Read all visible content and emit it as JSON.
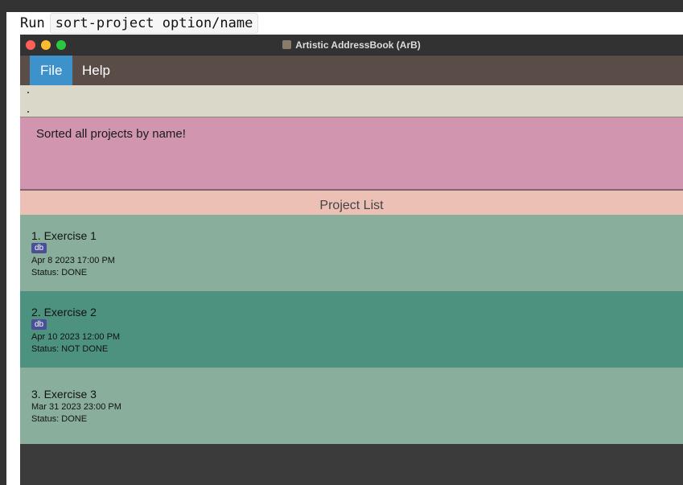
{
  "caption": {
    "prefix": "Run",
    "command": "sort-project option/name"
  },
  "window": {
    "title": "Artistic AddressBook (ArB)"
  },
  "menubar": {
    "items": [
      "File",
      "Help"
    ]
  },
  "result": {
    "message": "Sorted all projects by name!"
  },
  "list": {
    "header": "Project List",
    "projects": [
      {
        "title": "1.  Exercise 1",
        "tag": "db",
        "deadline": "Apr 8 2023 17:00 PM",
        "status": "Status: DONE",
        "selected": false
      },
      {
        "title": "2.  Exercise 2",
        "tag": "db",
        "deadline": "Apr 10 2023 12:00 PM",
        "status": "Status: NOT DONE",
        "selected": true
      },
      {
        "title": "3.  Exercise 3",
        "deadline": "Mar 31 2023 23:00 PM",
        "status": "Status: DONE",
        "selected": false
      }
    ]
  },
  "colors": {
    "menu_highlight": "#3e92cc",
    "result_bg": "#d195b0",
    "list_header_bg": "#ecc0b5",
    "card_bg": "#89af9c",
    "card_selected_bg": "#4d927f",
    "tag_bg": "#4a4f98"
  }
}
